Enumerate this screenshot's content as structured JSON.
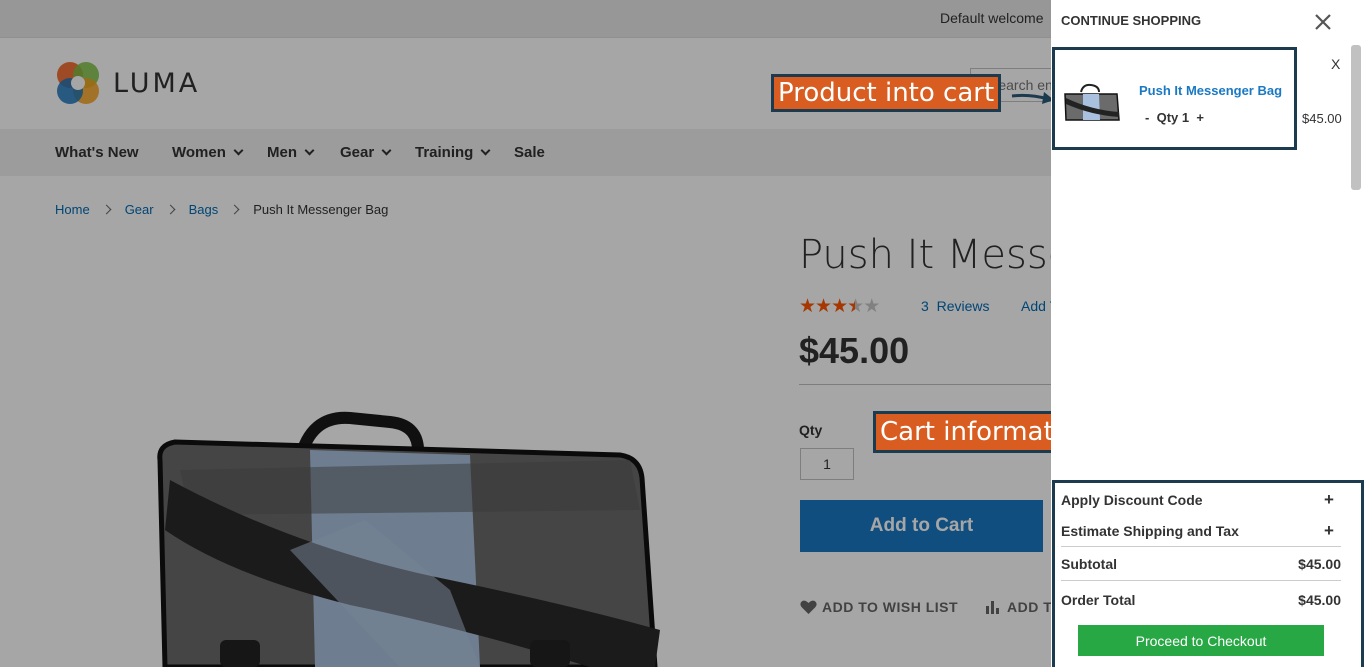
{
  "topbar": {
    "welcome": "Default welcome"
  },
  "header": {
    "logo_text": "LUMA",
    "search_placeholder": "Search entire store here..."
  },
  "nav": {
    "items": [
      {
        "label": "What's New",
        "has_dropdown": false
      },
      {
        "label": "Women",
        "has_dropdown": true
      },
      {
        "label": "Men",
        "has_dropdown": true
      },
      {
        "label": "Gear",
        "has_dropdown": true
      },
      {
        "label": "Training",
        "has_dropdown": true
      },
      {
        "label": "Sale",
        "has_dropdown": false
      }
    ]
  },
  "breadcrumbs": {
    "home": "Home",
    "gear": "Gear",
    "bags": "Bags",
    "current": "Push It Messenger Bag"
  },
  "product": {
    "title": "Push It Messenger Bag",
    "rating_stars": 3.5,
    "reviews_count": "3",
    "reviews_label": "Reviews",
    "add_review_label": "Add Your Review",
    "price": "$45.00",
    "qty_label": "Qty",
    "qty_value": "1",
    "add_to_cart": "Add to Cart",
    "wishlist": "ADD TO WISH LIST",
    "compare": "ADD TO COMPARE"
  },
  "minicart": {
    "header": "CONTINUE SHOPPING",
    "remove": "X",
    "item": {
      "name": "Push It Messenger Bag",
      "qty_minus": "-",
      "qty_label": "Qty 1",
      "qty_plus": "+",
      "price": "$45.00"
    },
    "apply_discount": "Apply Discount Code",
    "estimate_shipping": "Estimate Shipping and Tax",
    "plus": "+",
    "subtotal_label": "Subtotal",
    "subtotal_value": "$45.00",
    "order_total_label": "Order Total",
    "order_total_value": "$45.00",
    "checkout": "Proceed to Checkout"
  },
  "annotations": {
    "product_into_cart": "Product into cart",
    "cart_information": "Cart information"
  },
  "colors": {
    "accent_blue": "#1979c3",
    "annotation_orange": "#d95d20",
    "annotation_border": "#1d3b4f",
    "checkout_green": "#28a745",
    "rating_orange": "#ff5501"
  }
}
